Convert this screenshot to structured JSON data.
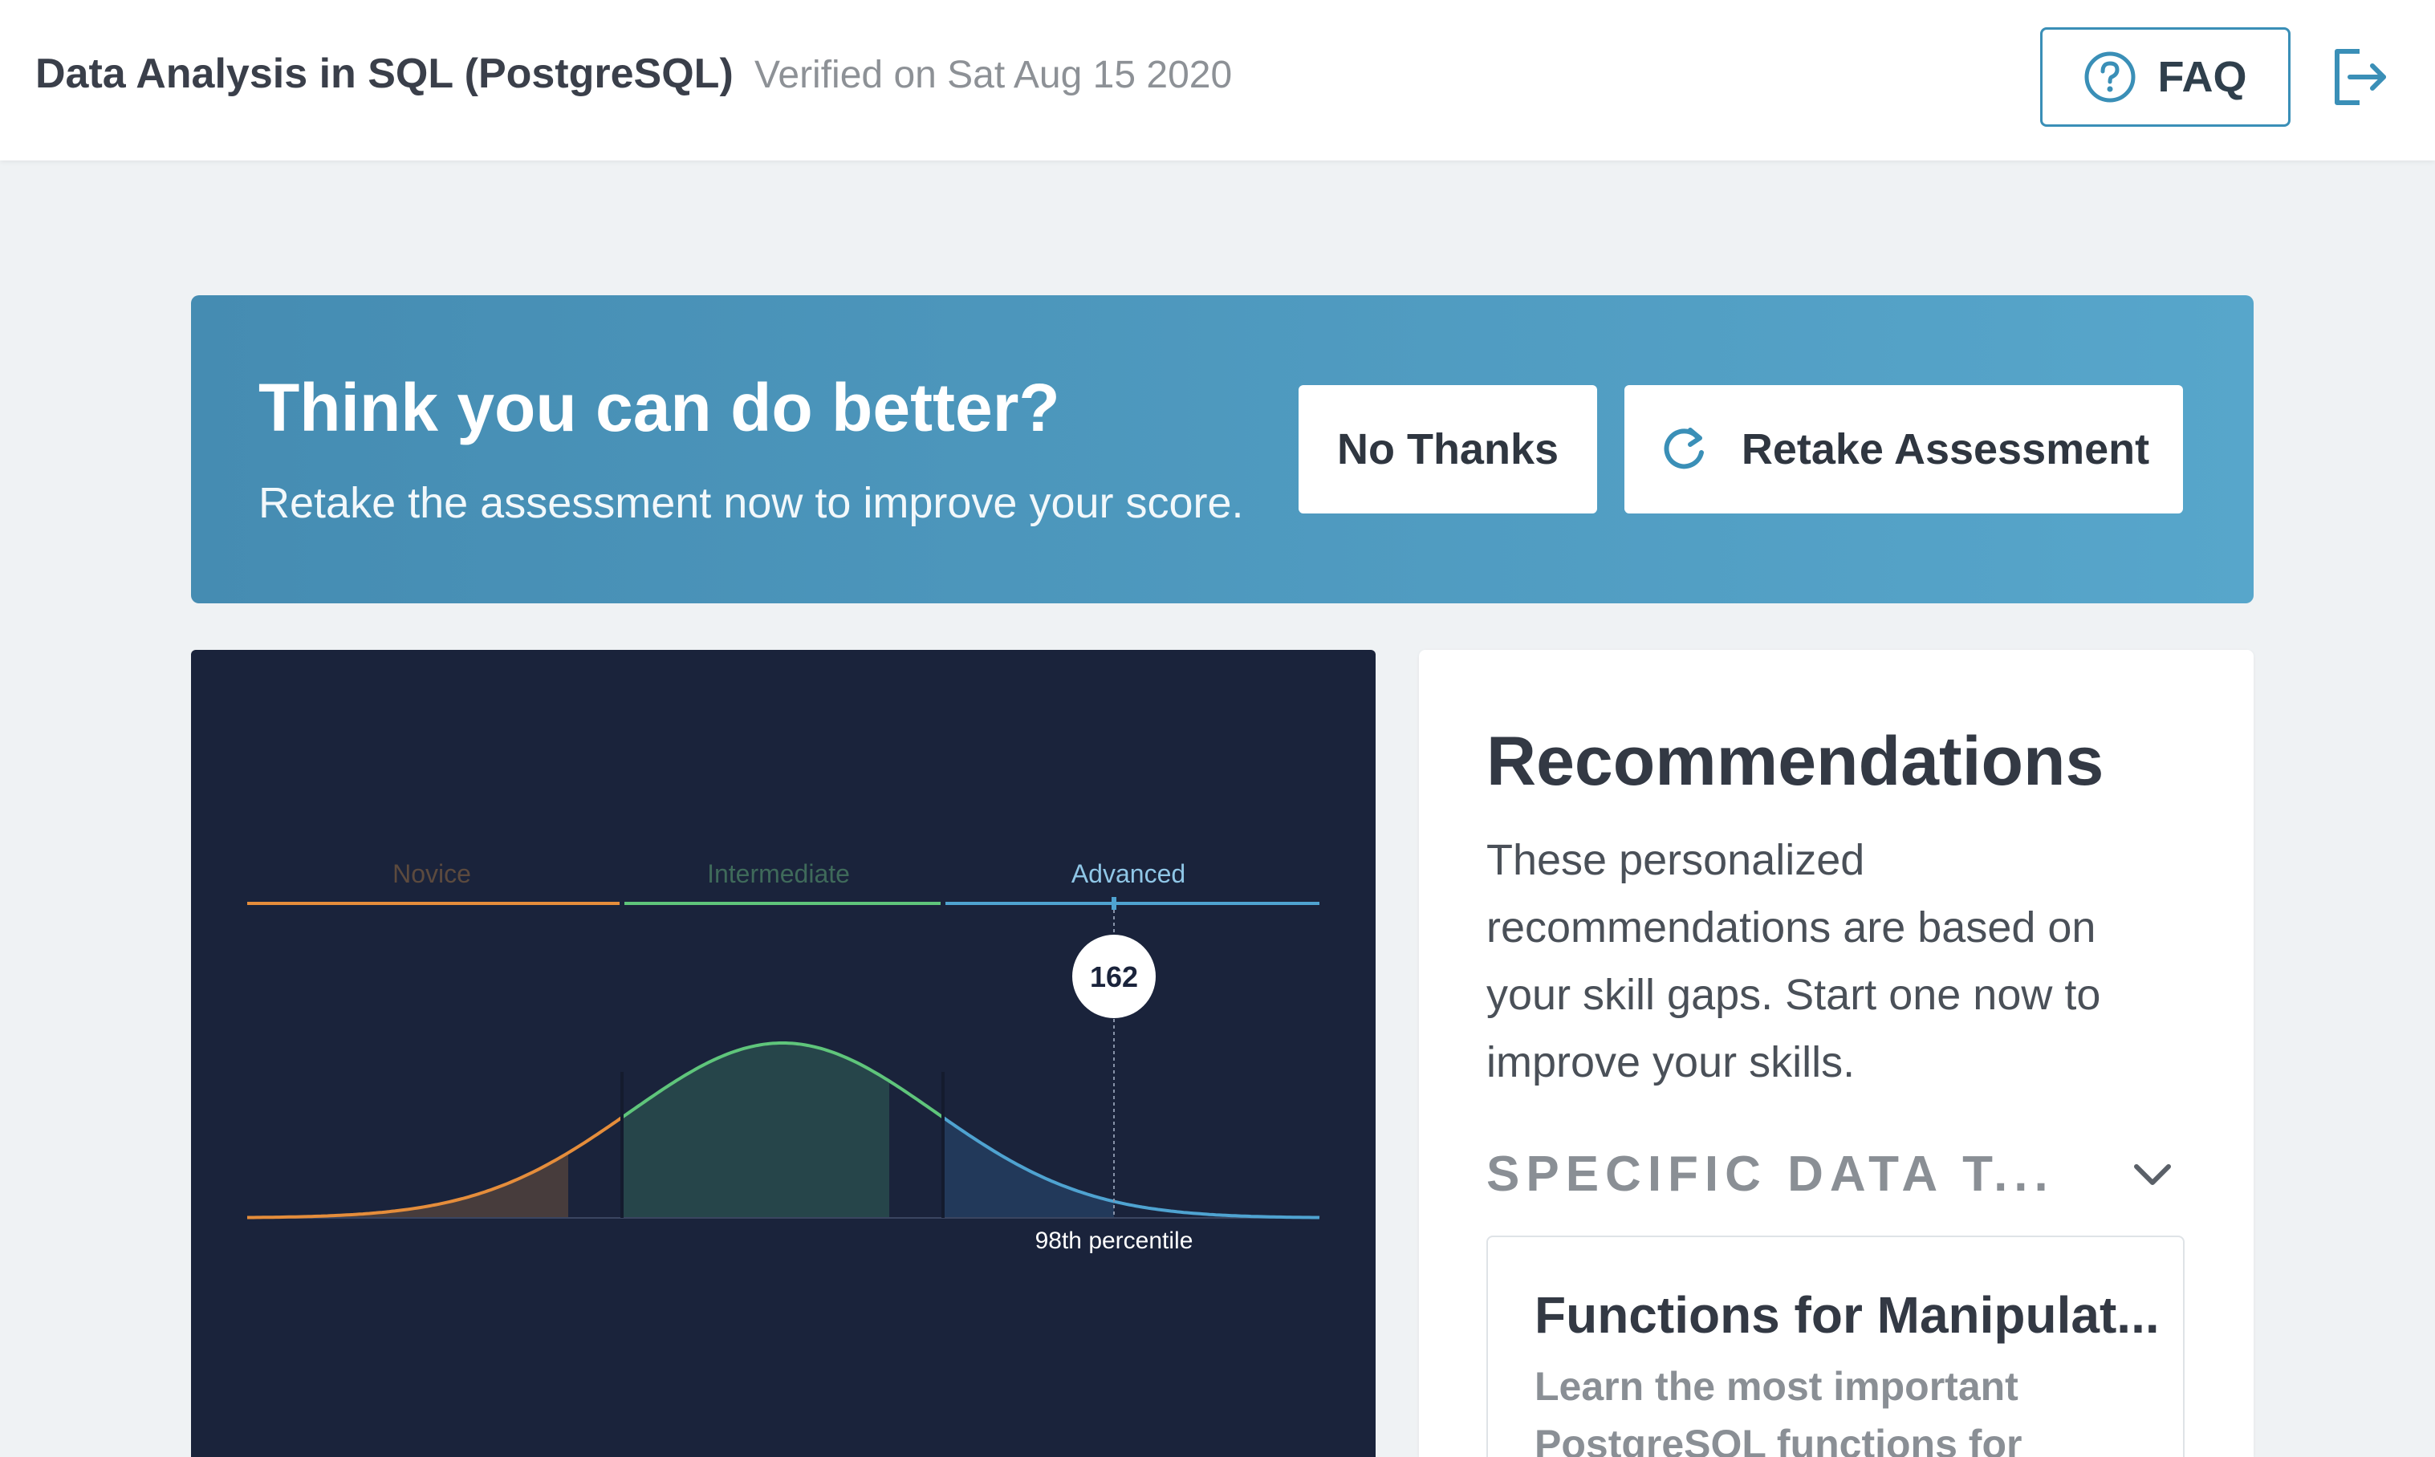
{
  "header": {
    "title": "Data Analysis in SQL (PostgreSQL)",
    "verified": "Verified on Sat Aug 15 2020",
    "faq_label": "FAQ",
    "faq_icon": "question-circle-icon",
    "logout_icon": "logout-icon"
  },
  "banner": {
    "title": "Think you can do better?",
    "subtitle": "Retake the assessment now to improve your score.",
    "no_thanks_label": "No Thanks",
    "retake_label": "Retake Assessment",
    "retake_icon": "refresh-icon"
  },
  "chart_data": {
    "type": "area",
    "bands": [
      {
        "name": "Novice",
        "color": "#e58d3b"
      },
      {
        "name": "Intermediate",
        "color": "#5fc57b"
      },
      {
        "name": "Advanced",
        "color": "#4fa3d1"
      }
    ],
    "score": "162",
    "score_percentile_label": "98th percentile",
    "score_percentile": 98
  },
  "recommendations": {
    "title": "Recommendations",
    "description": "These personalized recommendations are based on your skill gaps. Start one now to improve your skills.",
    "category_label": "SPECIFIC DATA T...",
    "course": {
      "title": "Functions for Manipulat...",
      "description": "Learn the most important PostgreSQL functions for"
    }
  }
}
